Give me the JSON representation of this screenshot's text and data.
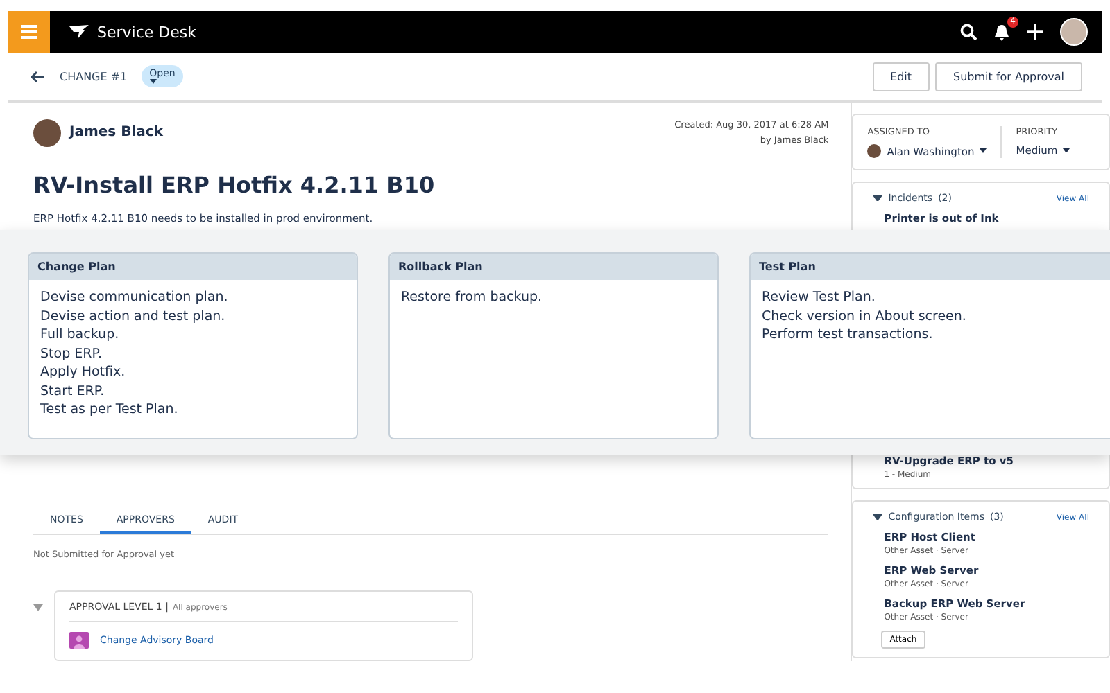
{
  "topbar": {
    "app_title": "Service Desk",
    "notification_count": "4"
  },
  "subheader": {
    "record": "CHANGE #1",
    "status": "Open",
    "buttons": [
      "Edit",
      "Submit for Approval"
    ]
  },
  "record": {
    "author": "James Black",
    "created": "Created: Aug 30, 2017 at 6:28 AM",
    "created_by": "by James Black",
    "title": "RV-Install ERP Hotfix 4.2.11 B10",
    "description": "ERP Hotfix 4.2.11 B10 needs to be installed in prod environment."
  },
  "tabs": [
    {
      "label": "NOTES",
      "selected": false
    },
    {
      "label": "APPROVERS",
      "selected": true
    },
    {
      "label": "AUDIT",
      "selected": false
    }
  ],
  "approval_note": "Not Submitted for Approval yet",
  "approval_levels": [
    {
      "title": "APPROVAL LEVEL 1 |",
      "subtitle": "All approvers",
      "approvers": [
        "Change Advisory Board"
      ]
    }
  ],
  "side": {
    "assigned_to": {
      "label": "ASSIGNED TO",
      "value": "Alan Washington"
    },
    "priority": {
      "label": "PRIORITY",
      "value": "Medium"
    },
    "sections": [
      {
        "title": "Incidents",
        "count": "(2)",
        "view_all": "View All",
        "items": [
          {
            "name": "Printer is out of Ink"
          },
          {
            "name": "RV-Upgrade ERP to v5",
            "meta": "1 - Medium"
          }
        ]
      },
      {
        "title": "Configuration Items",
        "count": "(3)",
        "view_all": "View All",
        "items": [
          {
            "name": "ERP Host Client",
            "meta": "Other Asset · Server"
          },
          {
            "name": "ERP Web Server",
            "meta": "Other Asset · Server"
          },
          {
            "name": "Backup ERP Web Server",
            "meta": "Other Asset · Server"
          }
        ],
        "button": "Attach"
      }
    ]
  },
  "plans": [
    {
      "title": "Change Plan",
      "lines": [
        "Devise communication plan.",
        "Devise action and test plan.",
        "Full backup.",
        "Stop ERP.",
        "Apply Hotfix.",
        "Start ERP.",
        "Test as per Test Plan."
      ]
    },
    {
      "title": "Rollback Plan",
      "lines": [
        "Restore from backup."
      ]
    },
    {
      "title": "Test Plan",
      "lines": [
        "Review Test Plan.",
        "Check version in About screen.",
        "Perform test transactions."
      ]
    }
  ]
}
